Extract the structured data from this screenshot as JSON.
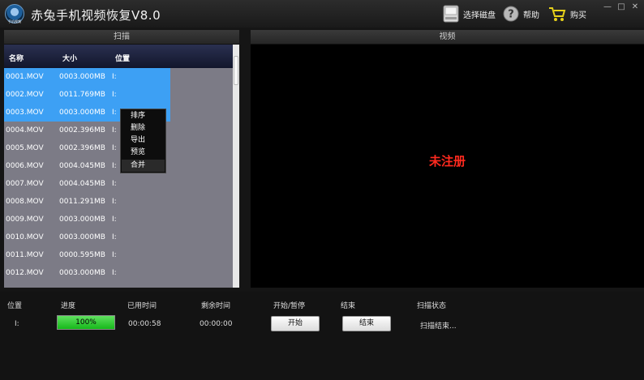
{
  "titlebar": {
    "logo_text": "手机视频",
    "title": "赤兔手机视频恢复V8.0",
    "select_disk": "选择磁盘",
    "help": "帮助",
    "buy": "购买",
    "minimize": "—",
    "maximize": "□",
    "close": "✕"
  },
  "scan_panel": {
    "title": "扫描"
  },
  "video_panel": {
    "title": "视频",
    "watermark": "未注册"
  },
  "list": {
    "columns": [
      "名称",
      "大小",
      "位置"
    ],
    "rows": [
      {
        "name": "0001.MOV",
        "size": "0003.000MB",
        "loc": "I:",
        "selected": true
      },
      {
        "name": "0002.MOV",
        "size": "0011.769MB",
        "loc": "I:",
        "selected": true
      },
      {
        "name": "0003.MOV",
        "size": "0003.000MB",
        "loc": "I:",
        "selected": true
      },
      {
        "name": "0004.MOV",
        "size": "0002.396MB",
        "loc": "I:",
        "selected": false
      },
      {
        "name": "0005.MOV",
        "size": "0002.396MB",
        "loc": "I:",
        "selected": false
      },
      {
        "name": "0006.MOV",
        "size": "0004.045MB",
        "loc": "I:",
        "selected": false
      },
      {
        "name": "0007.MOV",
        "size": "0004.045MB",
        "loc": "I:",
        "selected": false
      },
      {
        "name": "0008.MOV",
        "size": "0011.291MB",
        "loc": "I:",
        "selected": false
      },
      {
        "name": "0009.MOV",
        "size": "0003.000MB",
        "loc": "I:",
        "selected": false
      },
      {
        "name": "0010.MOV",
        "size": "0003.000MB",
        "loc": "I:",
        "selected": false
      },
      {
        "name": "0011.MOV",
        "size": "0000.595MB",
        "loc": "I:",
        "selected": false
      },
      {
        "name": "0012.MOV",
        "size": "0003.000MB",
        "loc": "I:",
        "selected": false
      }
    ]
  },
  "context_menu": {
    "items": [
      "排序",
      "删除",
      "导出",
      "预览",
      "合并"
    ],
    "highlighted": 4
  },
  "status": {
    "headers": [
      "位置",
      "进度",
      "已用时间",
      "剩余时间",
      "开始/暂停",
      "结束",
      "扫描状态"
    ],
    "location": "I:",
    "progress": 1.0,
    "progress_text": "100%",
    "elapsed": "00:00:58",
    "remaining": "00:00:00",
    "start_label": "开始",
    "end_label": "结束",
    "scan_state": "扫描结束..."
  },
  "colors": {
    "selection": "#3da0f4",
    "watermark": "#ff2a1f",
    "progress": "#16b81a"
  }
}
